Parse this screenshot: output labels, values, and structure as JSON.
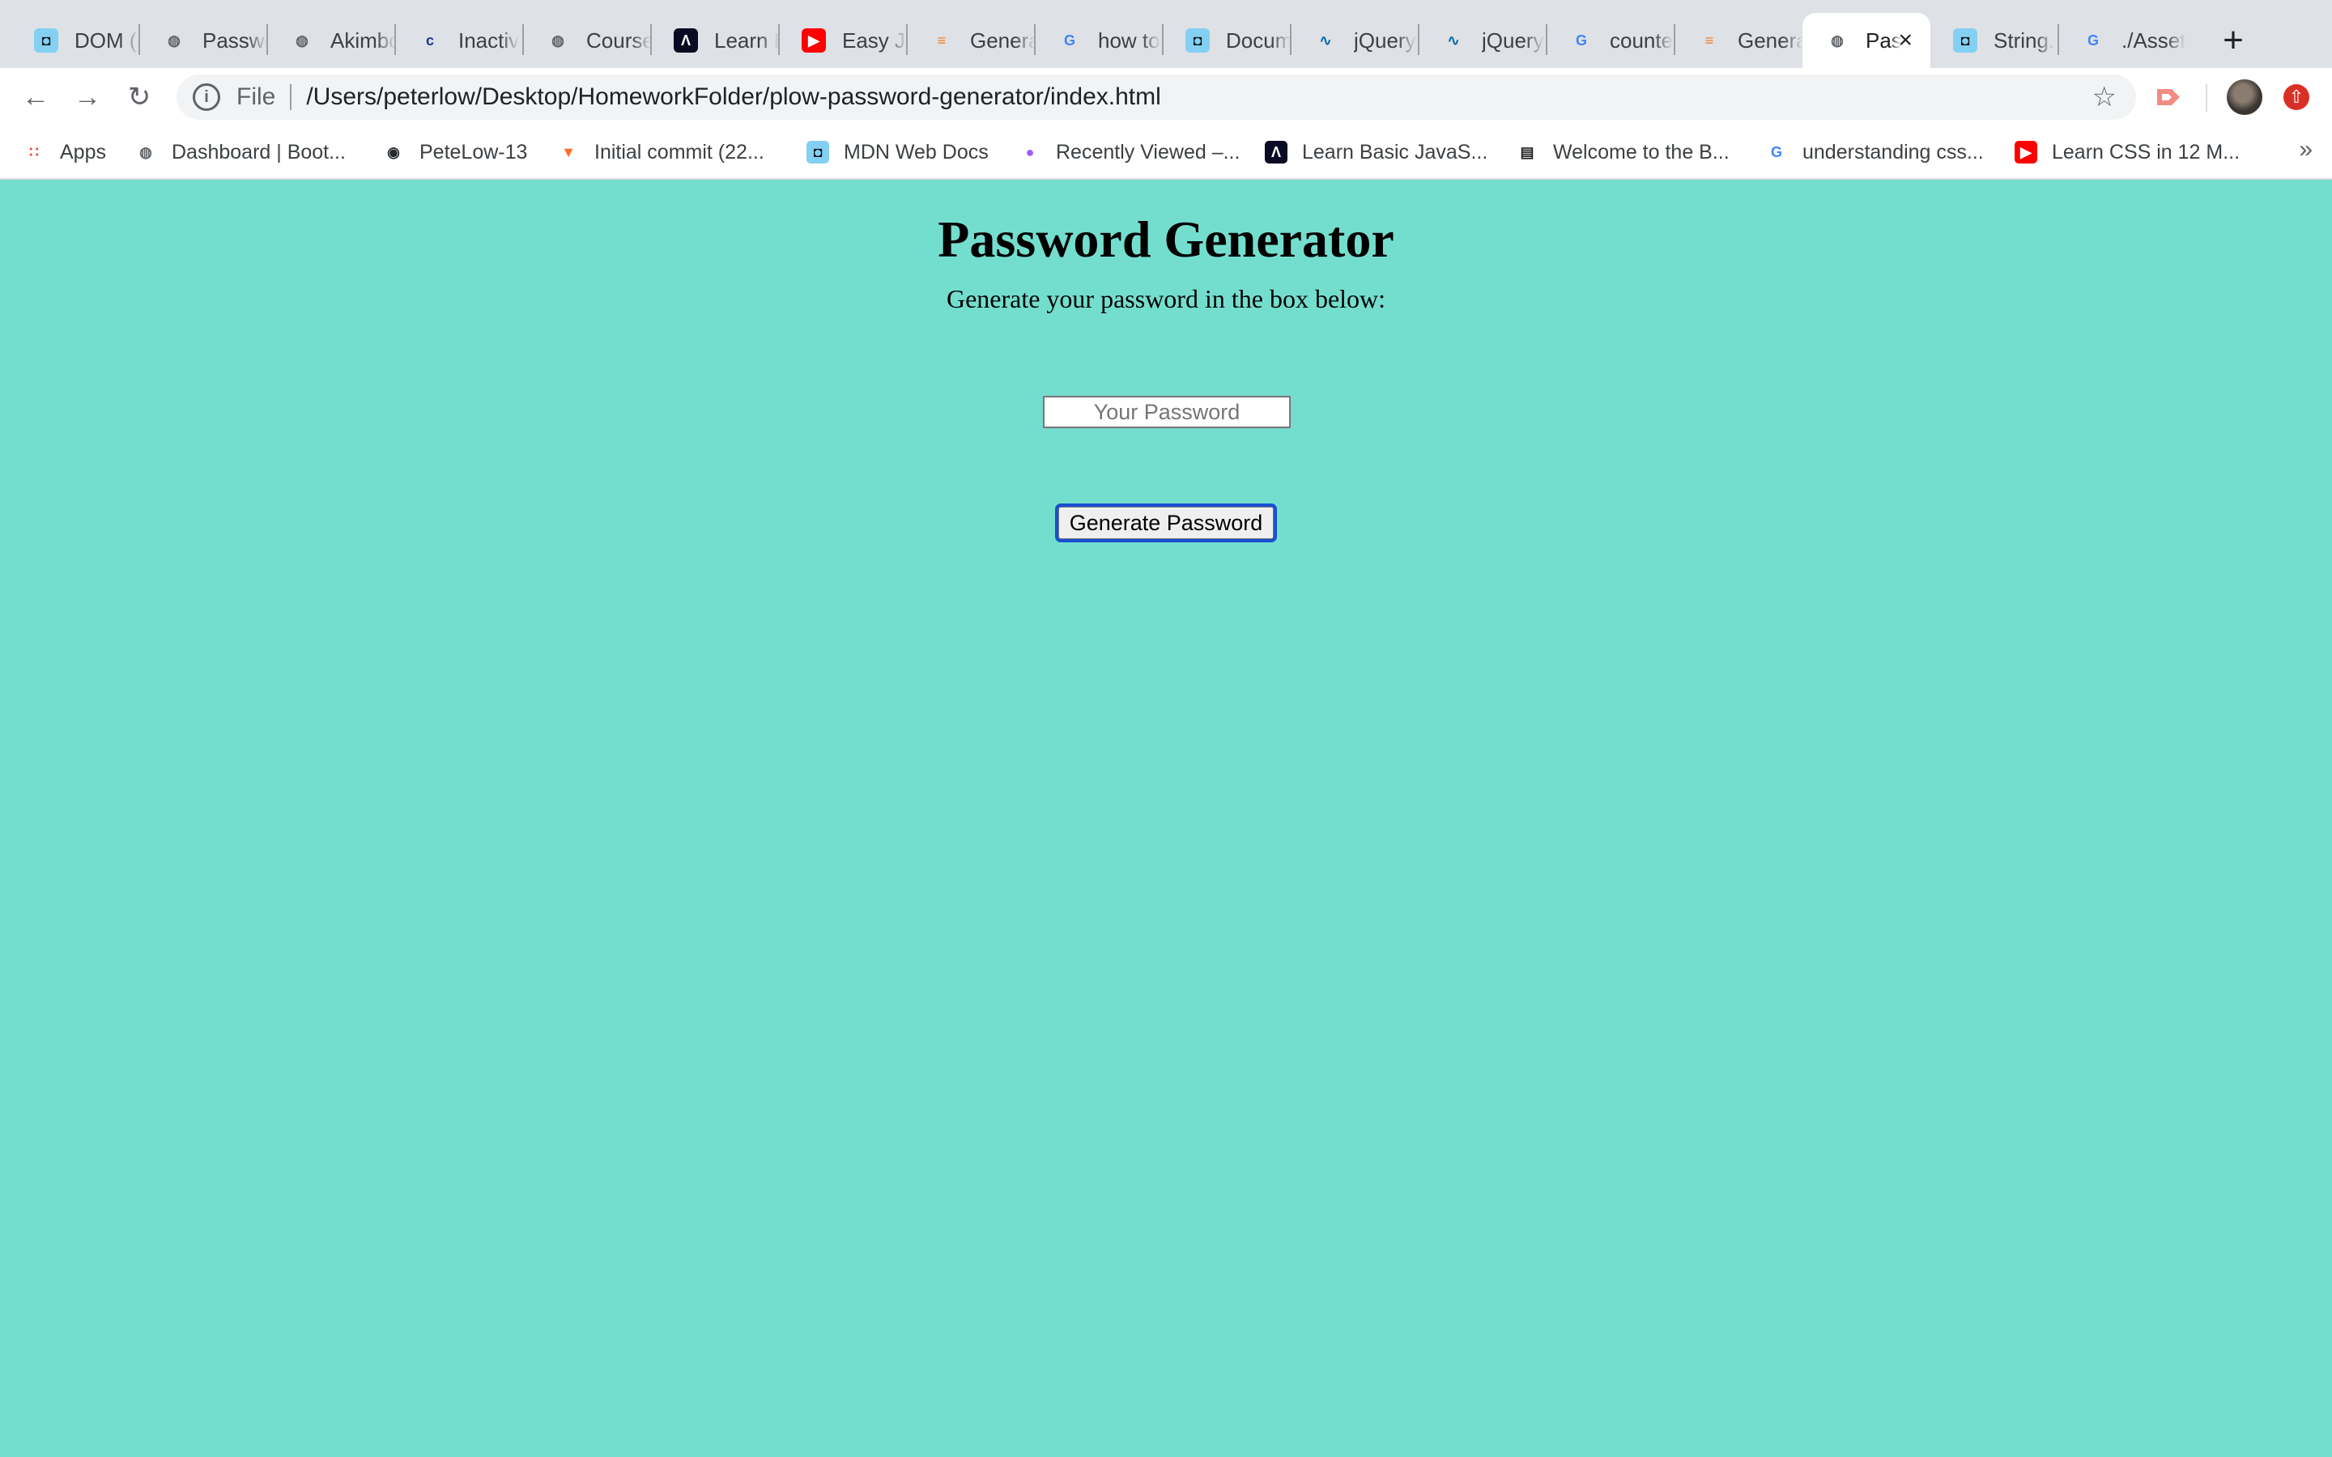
{
  "browser": {
    "tabs": [
      {
        "title": "DOM (I",
        "icon": "mdn-icon",
        "active": false
      },
      {
        "title": "Passwo",
        "icon": "globe-icon",
        "active": false
      },
      {
        "title": "Akimbo",
        "icon": "globe-icon",
        "active": false
      },
      {
        "title": "Inactiv",
        "icon": "citi-icon",
        "active": false
      },
      {
        "title": "Course",
        "icon": "globe-icon",
        "active": false
      },
      {
        "title": "Learn B",
        "icon": "freecodecamp-icon",
        "active": false
      },
      {
        "title": "Easy Ja",
        "icon": "youtube-icon",
        "active": false
      },
      {
        "title": "Genera",
        "icon": "stackoverflow-icon",
        "active": false
      },
      {
        "title": "how to",
        "icon": "google-icon",
        "active": false
      },
      {
        "title": "Docum",
        "icon": "mdn-icon",
        "active": false
      },
      {
        "title": "jQuery",
        "icon": "jquery-icon",
        "active": false
      },
      {
        "title": "jQuery",
        "icon": "jquery-icon",
        "active": false
      },
      {
        "title": "counte",
        "icon": "google-icon",
        "active": false
      },
      {
        "title": "Genera",
        "icon": "stackoverflow-icon",
        "active": false
      },
      {
        "title": "Pas",
        "icon": "globe-icon",
        "active": true
      },
      {
        "title": "String.",
        "icon": "mdn-icon",
        "active": false
      },
      {
        "title": "./Asset",
        "icon": "google-icon",
        "active": false
      }
    ],
    "new_tab": "+",
    "address_scheme": "File",
    "address_url": "/Users/peterlow/Desktop/HomeworkFolder/plow-password-generator/index.html",
    "bookmarks": [
      {
        "label": "Apps",
        "icon": "apps-grid-icon"
      },
      {
        "label": "Dashboard | Boot...",
        "icon": "globe-icon"
      },
      {
        "label": "PeteLow-13",
        "icon": "github-icon"
      },
      {
        "label": "Initial commit (22...",
        "icon": "gitlab-icon"
      },
      {
        "label": "MDN Web Docs",
        "icon": "mdn-icon"
      },
      {
        "label": "Recently Viewed –...",
        "icon": "figma-icon"
      },
      {
        "label": "Learn Basic JavaS...",
        "icon": "freecodecamp-icon"
      },
      {
        "label": "Welcome to the B...",
        "icon": "book-icon"
      },
      {
        "label": "understanding css...",
        "icon": "google-icon"
      },
      {
        "label": "Learn CSS in 12 M...",
        "icon": "youtube-icon"
      }
    ],
    "bookmarks_more": "»"
  },
  "page": {
    "title": "Password Generator",
    "subtitle": "Generate your password in the box below:",
    "password_placeholder": "Your Password",
    "password_value": "",
    "generate_button_label": "Generate Password",
    "background_color": "#74dece"
  }
}
